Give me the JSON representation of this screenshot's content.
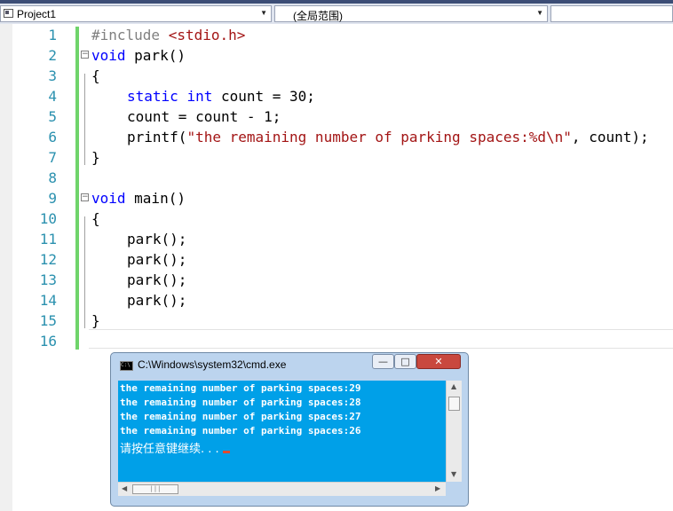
{
  "navbar": {
    "project_combo": "Project1",
    "scope_combo": "(全局范围)",
    "dropdown_arrow": "▼"
  },
  "editor": {
    "line_numbers": [
      "1",
      "2",
      "3",
      "4",
      "5",
      "6",
      "7",
      "8",
      "9",
      "10",
      "11",
      "12",
      "13",
      "14",
      "15",
      "16"
    ],
    "code": {
      "l1_pp": "#include ",
      "l1_str": "<stdio.h>",
      "l2_kw": "void",
      "l2_rest": " park()",
      "l3": "{",
      "l4_kw1": "static",
      "l4_sp": " ",
      "l4_kw2": "int",
      "l4_rest": " count = 30;",
      "l5": "count = count - 1;",
      "l6_fn": "printf(",
      "l6_str": "\"the remaining number of parking spaces:%d\\n\"",
      "l6_rest": ", count);",
      "l7": "}",
      "l9_kw": "void",
      "l9_rest": " main()",
      "l10": "{",
      "l11": "park();",
      "l12": "park();",
      "l13": "park();",
      "l14": "park();",
      "l15": "}"
    },
    "fold_marker": "−",
    "colors": {
      "keyword": "#0000ff",
      "string": "#a31515",
      "preprocessor": "#808080",
      "line_number": "#2b91af",
      "changebar": "#6fd46b"
    }
  },
  "console": {
    "title": "C:\\Windows\\system32\\cmd.exe",
    "icon_text": "C:\\",
    "buttons": {
      "minimize": "—",
      "maximize": "□",
      "close": "✕"
    },
    "output": [
      "the remaining number of parking spaces:29",
      "the remaining number of parking spaces:28",
      "the remaining number of parking spaces:27",
      "the remaining number of parking spaces:26"
    ],
    "prompt": "请按任意键继续. . .",
    "scroll": {
      "up": "▲",
      "down": "▼",
      "left": "◀",
      "right": "▶",
      "grip": "|||"
    },
    "colors": {
      "background": "#00a0e8",
      "text": "#ffffff",
      "cursor": "#e14a2f"
    }
  }
}
